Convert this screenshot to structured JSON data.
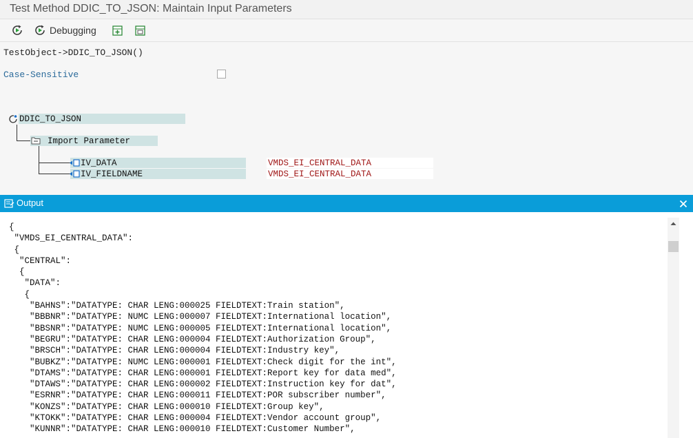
{
  "window": {
    "title": "Test Method DDIC_TO_JSON: Maintain Input Parameters"
  },
  "toolbar": {
    "execute_icon": "execute-icon",
    "debugging_label": "Debugging",
    "debug_icon": "debug-execute-icon",
    "insert_row_icon": "insert-row-icon",
    "delete_row_icon": "delete-row-icon"
  },
  "params": {
    "path": "TestObject->DDIC_TO_JSON()",
    "case_sensitive_label": "Case-Sensitive",
    "case_sensitive_checked": false
  },
  "tree": {
    "root": "DDIC_TO_JSON",
    "group": "Import Parameter",
    "items": [
      {
        "name": "IV_DATA",
        "type": "VMDS_EI_CENTRAL_DATA"
      },
      {
        "name": "IV_FIELDNAME",
        "type": "VMDS_EI_CENTRAL_DATA"
      }
    ]
  },
  "output": {
    "title": "Output",
    "lines": [
      "{",
      " \"VMDS_EI_CENTRAL_DATA\":",
      " {",
      "  \"CENTRAL\":",
      "  {",
      "   \"DATA\":",
      "   {",
      "    \"BAHNS\":\"DATATYPE: CHAR LENG:000025 FIELDTEXT:Train station\",",
      "    \"BBBNR\":\"DATATYPE: NUMC LENG:000007 FIELDTEXT:International location\",",
      "    \"BBSNR\":\"DATATYPE: NUMC LENG:000005 FIELDTEXT:International location\",",
      "    \"BEGRU\":\"DATATYPE: CHAR LENG:000004 FIELDTEXT:Authorization Group\",",
      "    \"BRSCH\":\"DATATYPE: CHAR LENG:000004 FIELDTEXT:Industry key\",",
      "    \"BUBKZ\":\"DATATYPE: NUMC LENG:000001 FIELDTEXT:Check digit for the int\",",
      "    \"DTAMS\":\"DATATYPE: CHAR LENG:000001 FIELDTEXT:Report key for data med\",",
      "    \"DTAWS\":\"DATATYPE: CHAR LENG:000002 FIELDTEXT:Instruction key for dat\",",
      "    \"ESRNR\":\"DATATYPE: CHAR LENG:000011 FIELDTEXT:POR subscriber number\",",
      "    \"KONZS\":\"DATATYPE: CHAR LENG:000010 FIELDTEXT:Group key\",",
      "    \"KTOKK\":\"DATATYPE: CHAR LENG:000004 FIELDTEXT:Vendor account group\",",
      "    \"KUNNR\":\"DATATYPE: CHAR LENG:000010 FIELDTEXT:Customer Number\","
    ]
  },
  "colors": {
    "accent": "#0a9dd9",
    "highlight": "#cfe3e3",
    "type_text": "#a01818",
    "label_blue": "#2a6a9a"
  }
}
